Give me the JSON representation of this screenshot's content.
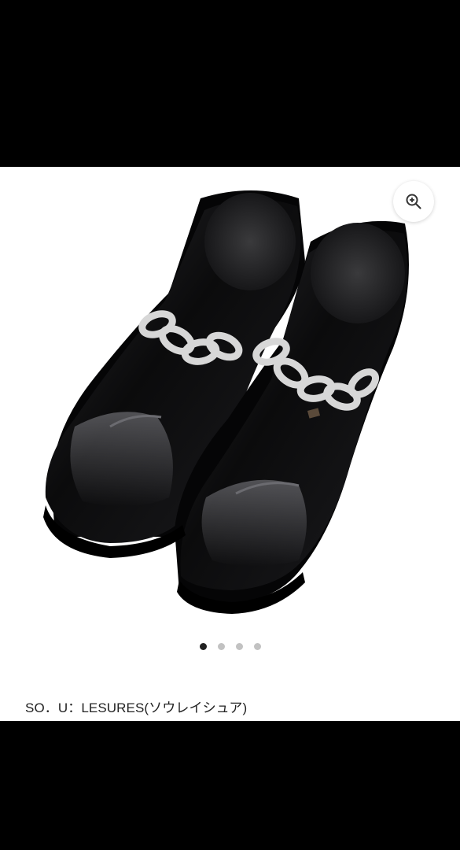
{
  "gallery": {
    "image_alt": "Black patent leather square-toe loafers with silver chain",
    "dots": [
      {
        "active": true
      },
      {
        "active": false
      },
      {
        "active": false
      },
      {
        "active": false
      }
    ],
    "zoom_icon": "zoom-in-icon"
  },
  "product": {
    "brand": "SO．U：LESURES(ソウレイシュア)"
  },
  "colors": {
    "background": "#ffffff",
    "frame": "#000000",
    "active_dot": "#222222",
    "inactive_dot": "#c2c2c2",
    "shoe": "#0b0b0c",
    "chain": "#d9d9d9"
  }
}
